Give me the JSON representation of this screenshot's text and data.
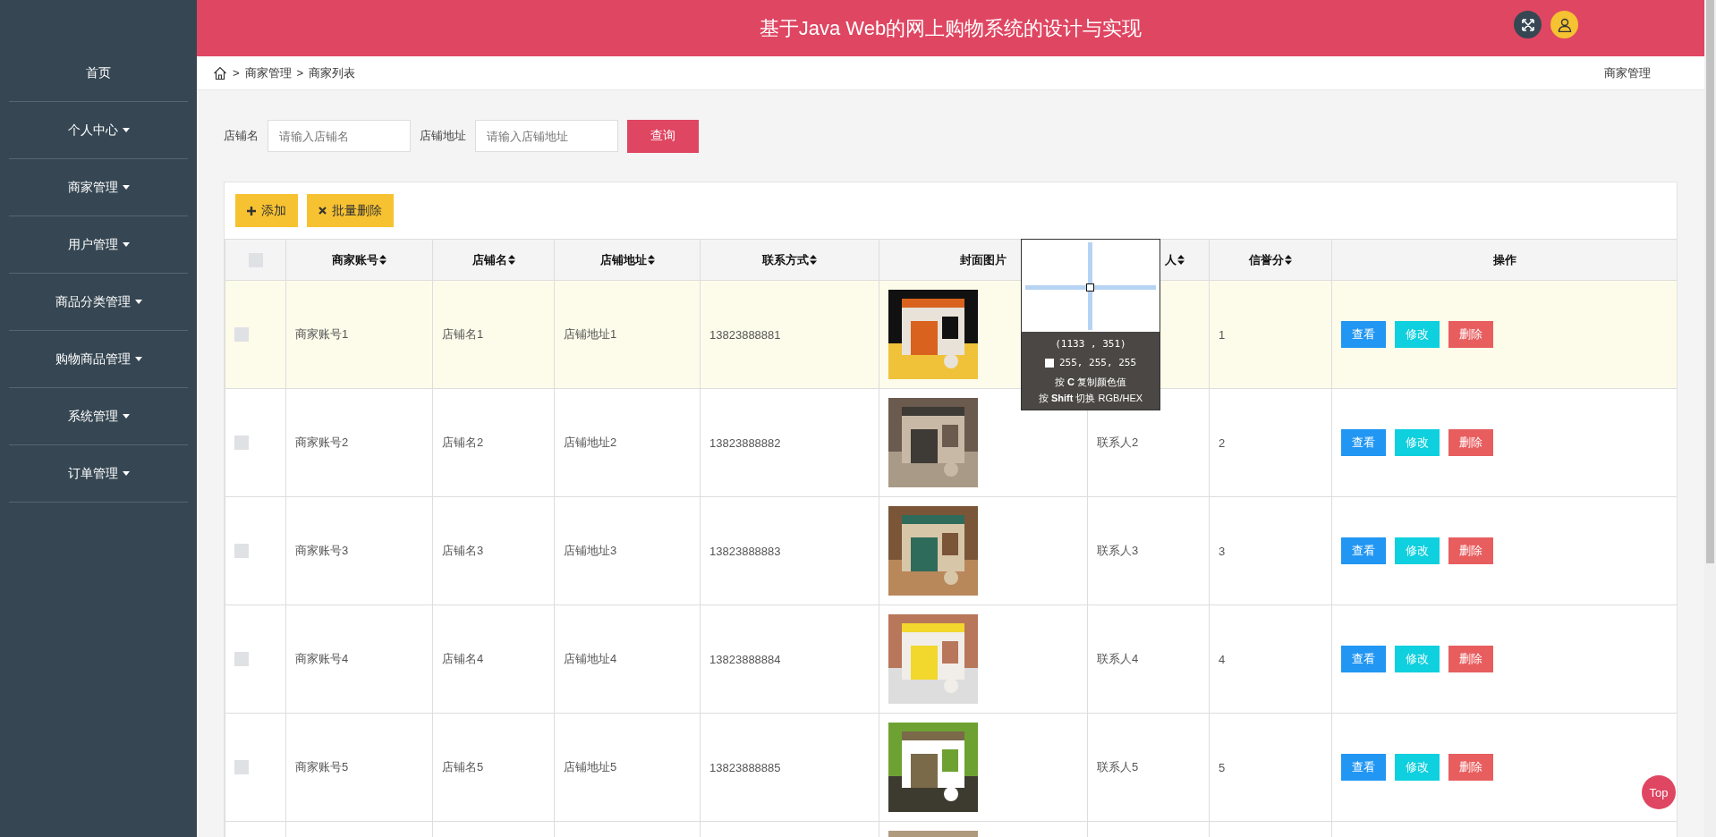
{
  "header": {
    "title": "基于Java Web的网上购物系统的设计与实现"
  },
  "sidebar": {
    "items": [
      {
        "label": "首页",
        "has_menu": false
      },
      {
        "label": "个人中心",
        "has_menu": true
      },
      {
        "label": "商家管理",
        "has_menu": true
      },
      {
        "label": "用户管理",
        "has_menu": true
      },
      {
        "label": "商品分类管理",
        "has_menu": true
      },
      {
        "label": "购物商品管理",
        "has_menu": true
      },
      {
        "label": "系统管理",
        "has_menu": true
      },
      {
        "label": "订单管理",
        "has_menu": true
      }
    ]
  },
  "breadcrumb": {
    "separator": ">",
    "items": [
      "商家管理",
      "商家列表"
    ],
    "current": "商家管理"
  },
  "search": {
    "fields": [
      {
        "label": "店铺名",
        "placeholder": "请输入店铺名"
      },
      {
        "label": "店铺地址",
        "placeholder": "请输入店铺地址"
      }
    ],
    "button": "查询"
  },
  "toolbar": [
    {
      "label": "添加",
      "kind": "add"
    },
    {
      "label": "批量删除",
      "kind": "delete"
    }
  ],
  "table": {
    "select_all_checked": false,
    "columns": [
      {
        "label": "商家账号",
        "sortable": true
      },
      {
        "label": "店铺名",
        "sortable": true
      },
      {
        "label": "店铺地址",
        "sortable": true
      },
      {
        "label": "联系方式",
        "sortable": true
      },
      {
        "label": "封面图片",
        "sortable": false
      },
      {
        "label": "人",
        "sortable": true,
        "covered_start": true
      },
      {
        "label": "信誉分",
        "sortable": true
      },
      {
        "label": "操作",
        "sortable": false
      }
    ],
    "rows": [
      {
        "checked": false,
        "highlighted": true,
        "account": "商家账号1",
        "name": "店铺名1",
        "address": "店铺地址1",
        "phone": "13823888881",
        "score": "1",
        "actions": [
          "查看",
          "修改",
          "删除"
        ]
      },
      {
        "checked": false,
        "highlighted": false,
        "account": "商家账号2",
        "name": "店铺名2",
        "address": "店铺地址2",
        "phone": "13823888882",
        "contact": "联系人2",
        "score": "2",
        "actions": [
          "查看",
          "修改",
          "删除"
        ]
      },
      {
        "checked": false,
        "highlighted": false,
        "account": "商家账号3",
        "name": "店铺名3",
        "address": "店铺地址3",
        "phone": "13823888883",
        "contact": "联系人3",
        "score": "3",
        "actions": [
          "查看",
          "修改",
          "删除"
        ]
      },
      {
        "checked": false,
        "highlighted": false,
        "account": "商家账号4",
        "name": "店铺名4",
        "address": "店铺地址4",
        "phone": "13823888884",
        "contact": "联系人4",
        "score": "4",
        "actions": [
          "查看",
          "修改",
          "删除"
        ]
      },
      {
        "checked": false,
        "highlighted": false,
        "account": "商家账号5",
        "name": "店铺名5",
        "address": "店铺地址5",
        "phone": "13823888885",
        "contact": "联系人5",
        "score": "5",
        "actions": [
          "查看",
          "修改",
          "删除"
        ]
      },
      {
        "highlighted": false
      }
    ]
  },
  "color_picker": {
    "coords": "(1133 , 351)",
    "value": "255, 255, 255",
    "hints": [
      "按 **C** 复制颜色值",
      "按 **Shift** 切换 RGB/HEX"
    ]
  },
  "top_button": "Top"
}
